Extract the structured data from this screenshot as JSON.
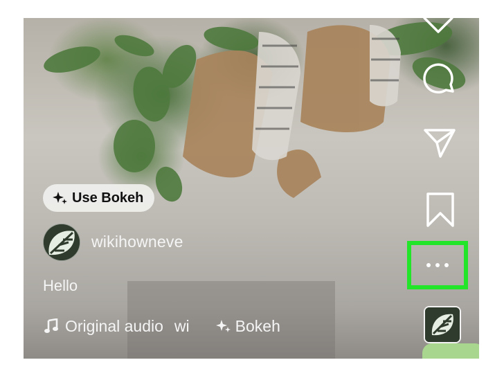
{
  "post": {
    "effect_button_label": "Use Bokeh",
    "username": "wikihowneve",
    "caption": "Hello",
    "audio_label": "Original audio",
    "audio_truncated": "wi",
    "effect_label": "Bokeh"
  },
  "rail": {
    "icons": [
      "heart-icon",
      "comment-icon",
      "share-icon",
      "bookmark-icon",
      "more-options-icon",
      "audio-thumbnail"
    ]
  },
  "annotation": {
    "highlight_color": "#22e52a"
  },
  "colors": {
    "overlay_text": "#f5f5f5",
    "pill_background": "#f0f0ee"
  }
}
